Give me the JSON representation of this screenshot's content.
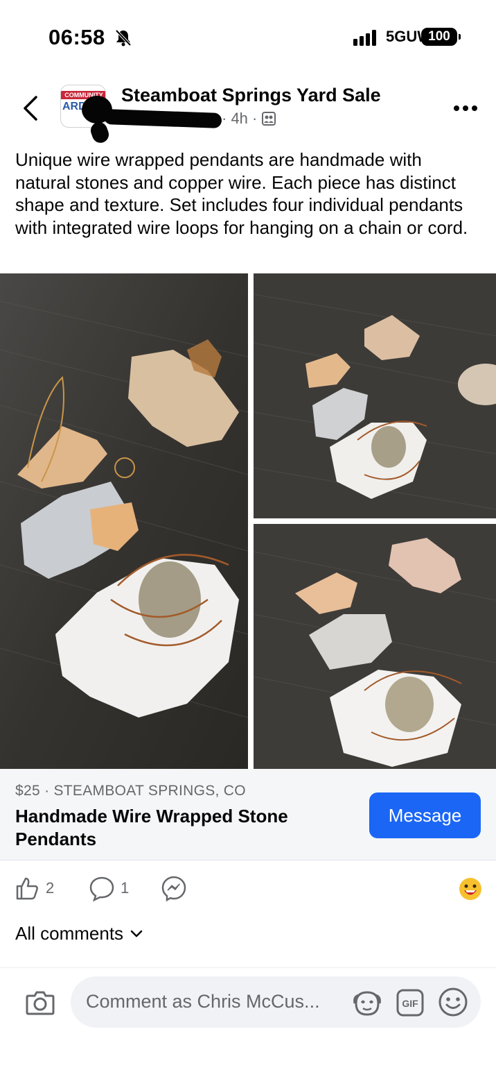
{
  "status": {
    "time": "06:58",
    "network": "5GUW",
    "battery": "100"
  },
  "header": {
    "group_name": "Steamboat Springs Yard Sale",
    "time_ago": "· 4h ·",
    "avatar_band": "COMMUNITY",
    "avatar_text": "ARD"
  },
  "post": {
    "text": "Unique wire wrapped pendants are handmade with natural stones and copper wire. Each piece has distinct shape and texture. Set includes four individual pendants with integrated wire loops for hanging on a chain or cord."
  },
  "listing": {
    "meta": "$25 · STEAMBOAT SPRINGS, CO",
    "title": "Handmade Wire Wrapped Stone Pendants",
    "message_label": "Message"
  },
  "reactions": {
    "likes": "2",
    "comments": "1"
  },
  "comments": {
    "all_label": "All comments"
  },
  "composer": {
    "placeholder": "Comment as Chris McCus..."
  },
  "icons": {
    "back": "chevron-left-icon",
    "more": "more-horizontal-icon",
    "like": "thumbs-up-icon",
    "comment": "comment-bubble-icon",
    "share": "messenger-icon",
    "camera": "camera-icon",
    "gif": "gif-icon",
    "emoji": "smiley-icon"
  },
  "colors": {
    "accent": "#1b66f5",
    "secondary_text": "#65676b",
    "listing_bg": "#f5f6f8"
  }
}
